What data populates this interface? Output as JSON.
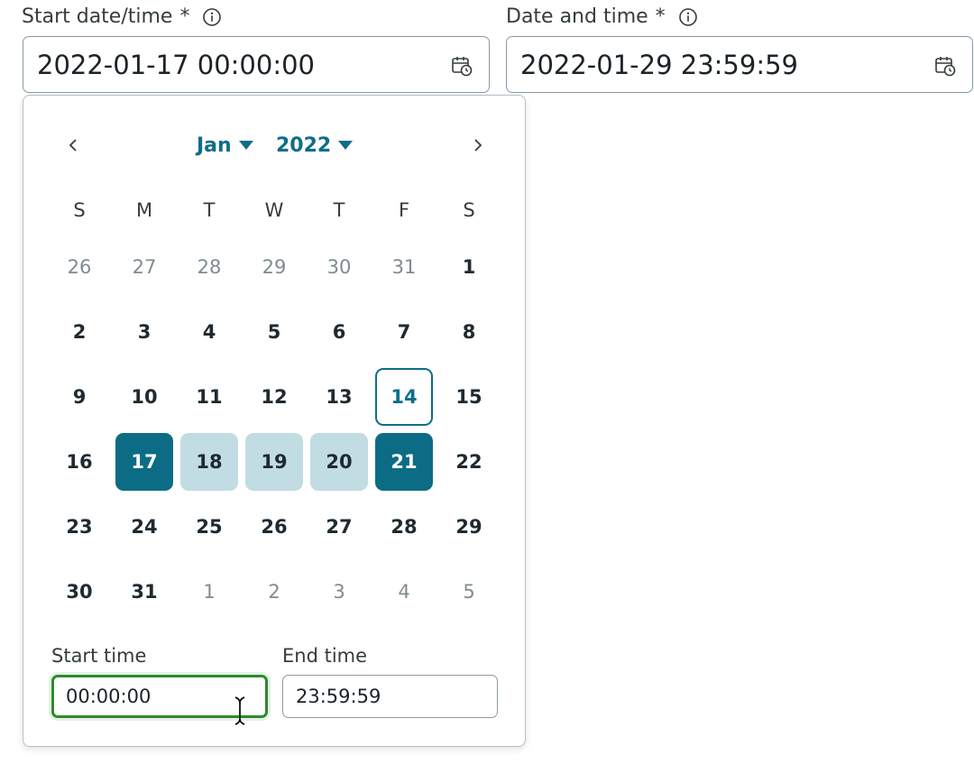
{
  "fields": {
    "start": {
      "label": "Start date/time",
      "required": "*",
      "value": "2022-01-17 00:00:00"
    },
    "end": {
      "label": "Date and time",
      "required": "*",
      "value": "2022-01-29 23:59:59"
    }
  },
  "calendar": {
    "month": "Jan",
    "year": "2022",
    "weekdays": [
      "S",
      "M",
      "T",
      "W",
      "T",
      "F",
      "S"
    ],
    "weeks": [
      [
        "26",
        "27",
        "28",
        "29",
        "30",
        "31",
        "1"
      ],
      [
        "2",
        "3",
        "4",
        "5",
        "6",
        "7",
        "8"
      ],
      [
        "9",
        "10",
        "11",
        "12",
        "13",
        "14",
        "15"
      ],
      [
        "16",
        "17",
        "18",
        "19",
        "20",
        "21",
        "22"
      ],
      [
        "23",
        "24",
        "25",
        "26",
        "27",
        "28",
        "29"
      ],
      [
        "30",
        "31",
        "1",
        "2",
        "3",
        "4",
        "5"
      ]
    ],
    "outside_month_positions": [
      [
        0,
        0
      ],
      [
        0,
        1
      ],
      [
        0,
        2
      ],
      [
        0,
        3
      ],
      [
        0,
        4
      ],
      [
        0,
        5
      ],
      [
        5,
        2
      ],
      [
        5,
        3
      ],
      [
        5,
        4
      ],
      [
        5,
        5
      ],
      [
        5,
        6
      ]
    ],
    "today": "14",
    "selected_start": "17",
    "selected_end": "21",
    "in_range": [
      "18",
      "19",
      "20"
    ]
  },
  "time": {
    "start_label": "Start time",
    "start_value": "00:00:00",
    "end_label": "End time",
    "end_value": "23:59:59"
  },
  "colors": {
    "accent": "#0f6d8a",
    "selected_bg": "#0c6c86",
    "range_bg": "#c2dce3",
    "focus_border": "#2e8a2e"
  }
}
